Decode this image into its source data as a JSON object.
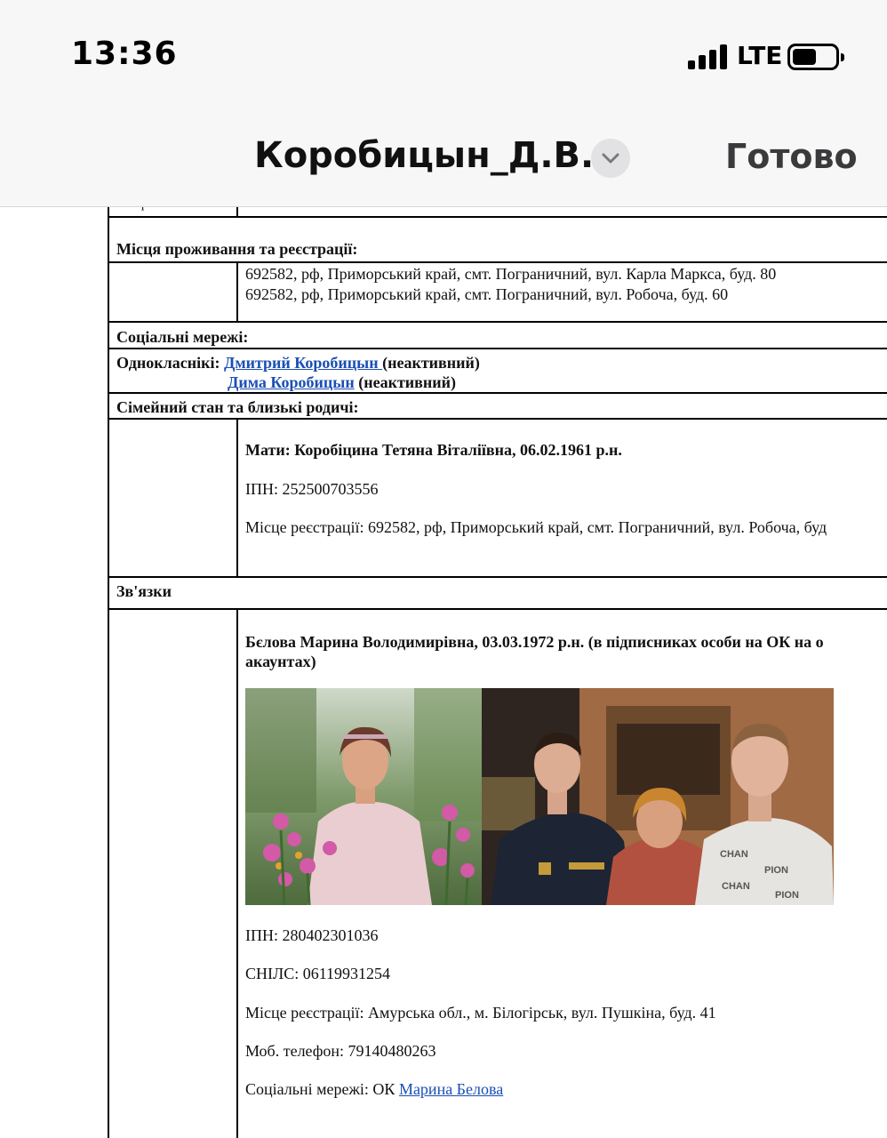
{
  "status_bar": {
    "time": "13:36",
    "network": "LTE"
  },
  "nav": {
    "title": "Коробицын_Д.В.",
    "done_label": "Готово",
    "menu_icon": "chevron-down-icon"
  },
  "doc": {
    "cut_label": "телефон:",
    "residence": {
      "heading": "Місця проживання та реєстрації:",
      "addresses": [
        "692582, рф, Приморський край, смт. Пограничний, вул. Карла Маркса, буд. 80",
        "692582, рф, Приморський край, смт. Пограничний, вул. Робоча, буд. 60"
      ]
    },
    "social": {
      "heading": "Соціальні мережі:",
      "ok_label": "Однокласнікі:",
      "accounts": [
        {
          "name": "Дмитрий Коробицын ",
          "status": "(неактивний)"
        },
        {
          "name": "Дима Коробицын",
          "status": "(неактивний)"
        }
      ]
    },
    "family": {
      "heading": "Сімейний стан та близькі родичі:",
      "mother": "Мати: Коробіцина Тетяна Віталіївна, 06.02.1961 р.н.",
      "ipn": "ІПН: 252500703556",
      "registration": "Місце реєстрації: 692582, рф, Приморський край, смт. Пограничний, вул. Робоча, буд"
    },
    "links": {
      "heading": "Зв'язки",
      "person_line1": "Бєлова Марина Володимирівна, 03.03.1972 р.н. (в підписниках особи на ОК на о",
      "person_line2": "акаунтах)",
      "ipn": "ІПН: 280402301036",
      "snils": "СНІЛС: 06119931254",
      "registration": "Місце реєстрації: Амурська обл., м. Білогірськ, вул. Пушкіна, буд. 41",
      "phone": "Моб. телефон: 79140480263",
      "social_prefix": "Соціальні мережі: ОК ",
      "social_link": "Марина Белова"
    }
  }
}
